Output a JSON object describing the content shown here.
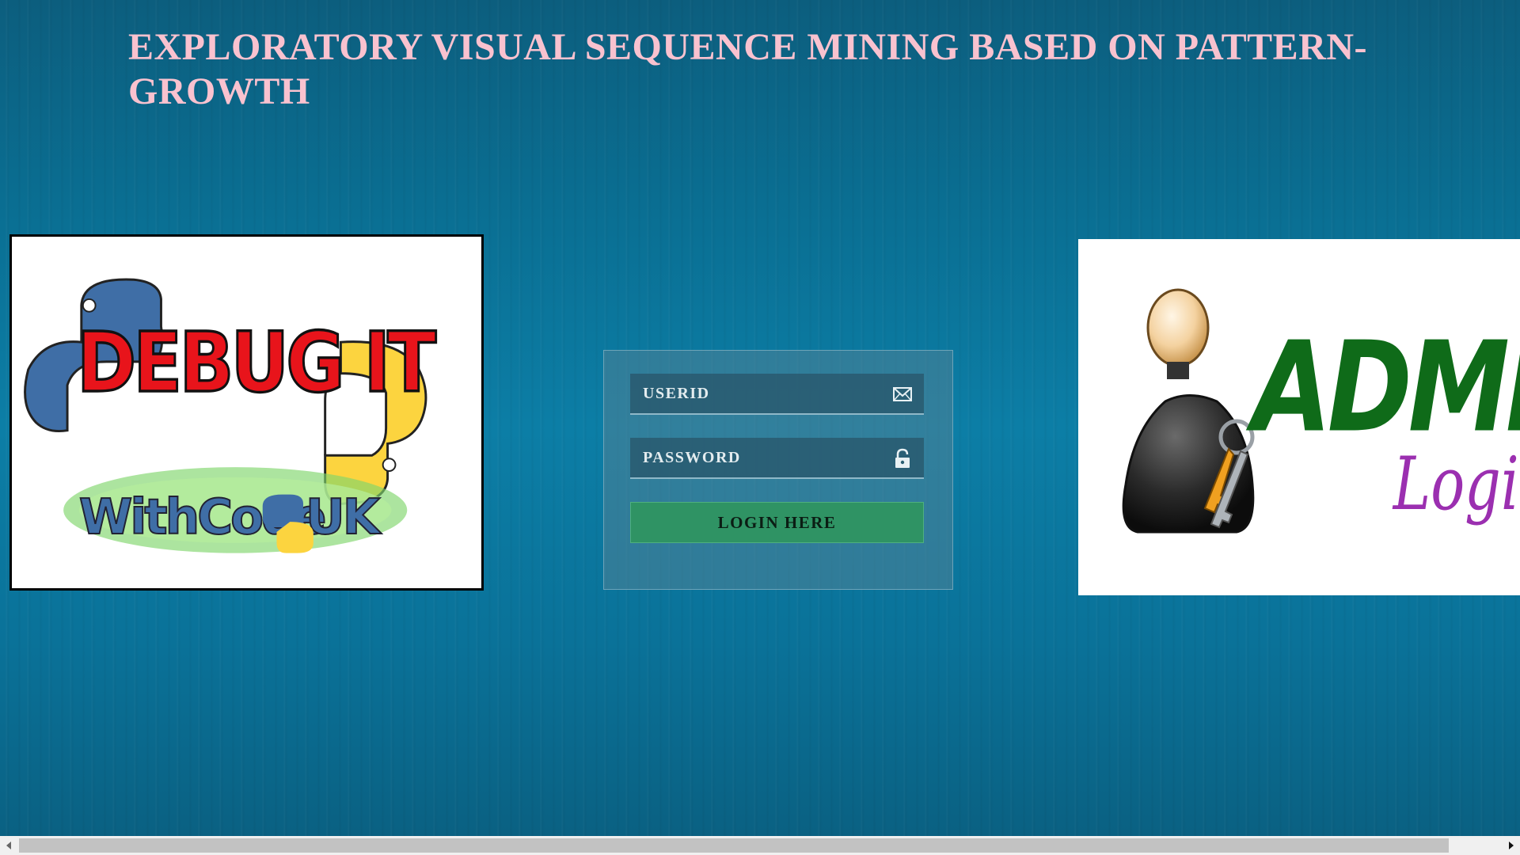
{
  "page": {
    "title": "EXPLORATORY VISUAL SEQUENCE MINING BASED ON PATTERN-GROWTH"
  },
  "left_logo": {
    "text_main": "DEBUG IT",
    "text_sub_1": "WithCode",
    "text_sub_2": "UK",
    "icon": "python-logo-icon"
  },
  "right_logo": {
    "text_main": "ADMIN",
    "text_sub": "Login",
    "icon": "admin-user-with-keys-icon"
  },
  "login": {
    "userid_placeholder": "USERID",
    "password_placeholder": "PASSWORD",
    "userid_icon": "envelope-icon",
    "password_icon": "lock-icon",
    "button_label": "LOGIN HERE",
    "button_color": "#2f9364"
  },
  "colors": {
    "title": "#f9c2cf",
    "background": "#0b7299"
  },
  "scrollbar": {
    "visible_fraction": 0.965
  }
}
